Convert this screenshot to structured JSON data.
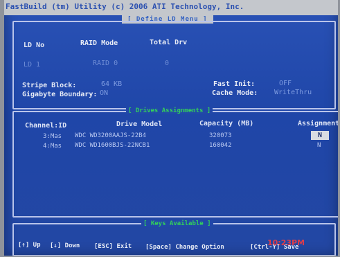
{
  "title": "FastBuild (tm) Utility (c) 2006 ATI Technology, Inc.",
  "subtitle": "[ Define LD Menu ]",
  "ld_header": {
    "ld_no": "LD No",
    "raid_mode": "RAID Mode",
    "total_drv": "Total Drv"
  },
  "ld_row": {
    "ld_no": "LD 1",
    "raid_mode": "RAID 0",
    "total_drv": "0"
  },
  "settings": {
    "stripe_block_label": "Stripe Block:",
    "stripe_block_value": "64  KB",
    "gigabyte_boundary_label": "Gigabyte Boundary:",
    "gigabyte_boundary_value": "ON",
    "fast_init_label": "Fast Init:",
    "fast_init_value": "OFF",
    "cache_mode_label": "Cache Mode:",
    "cache_mode_value": "WriteThru"
  },
  "drives_legend": "[ Drives Assignments ]",
  "drives_table": {
    "headers": {
      "channel_id": "Channel:ID",
      "drive_model": "Drive Model",
      "capacity": "Capacity (MB)",
      "assignment": "Assignment"
    },
    "rows": [
      {
        "channel_id": "3:Mas",
        "drive_model": "WDC WD3200AAJS-22B4",
        "capacity": "320073",
        "assignment": "N"
      },
      {
        "channel_id": "4:Mas",
        "drive_model": "WDC WD1600BJS-22NCB1",
        "capacity": "160042",
        "assignment": "N"
      }
    ]
  },
  "keys_legend": "[ Keys Available ]",
  "keys": {
    "up": "[↑] Up",
    "down": "[↓] Down",
    "esc": "[ESC] Exit",
    "space": "[Space] Change Option",
    "save": "[Ctrl-Y] Save"
  },
  "camera_timestamp": "10:23PM",
  "colors": {
    "background": "#2148a8",
    "title_bar": "#c4c7cc",
    "legend_green": "#33d05a",
    "timestamp_red": "#ff3b3b"
  }
}
